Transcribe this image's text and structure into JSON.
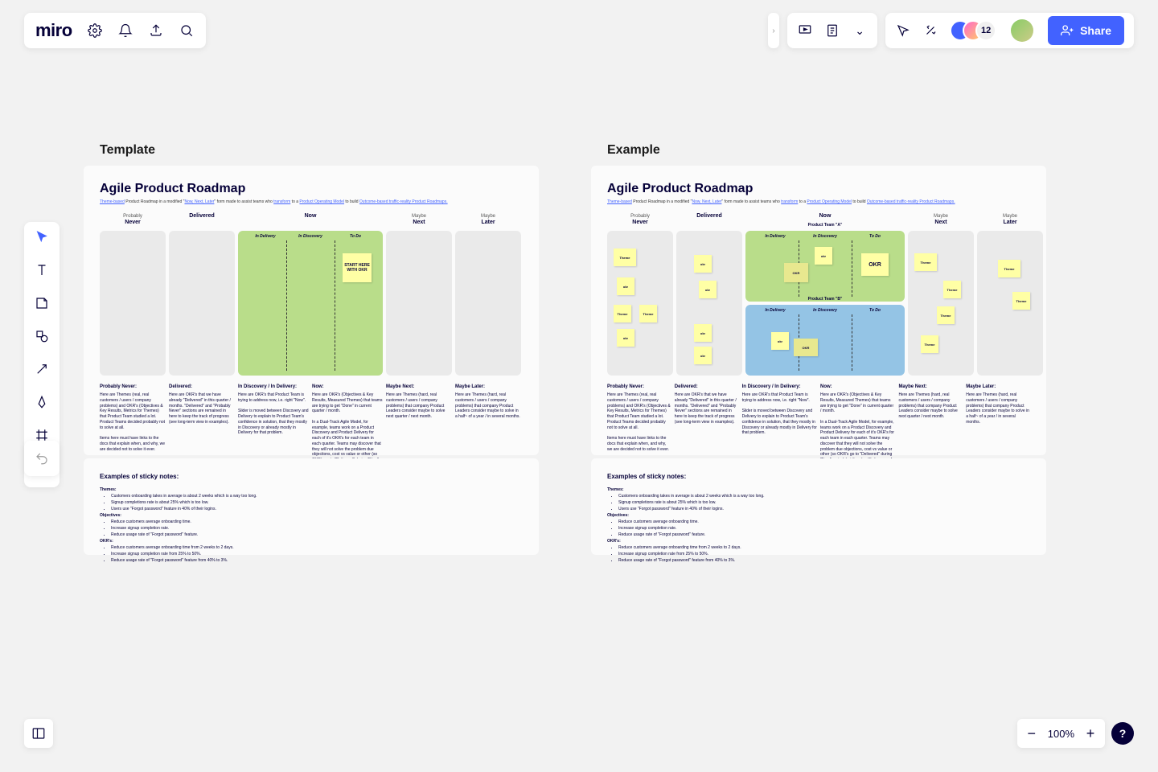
{
  "logo": "miro",
  "share_label": "Share",
  "avatar_count": "12",
  "zoom": "100%",
  "help": "?",
  "section_template": "Template",
  "section_example": "Example",
  "card": {
    "title": "Agile Product Roadmap",
    "sub_prefix": "Theme-based",
    "sub_mid": " Product Roadmap in a modified \"",
    "sub_link1": "Now, Next, Later",
    "sub_mid2": "\" form made to assist teams who ",
    "sub_link2": "transform",
    "sub_mid3": " to a ",
    "sub_link3": "Product Operating Model",
    "sub_mid4": " to build ",
    "sub_link4": "Outcome-based traffic-reality Product Roadmaps.",
    "lanes": {
      "never_sup": "Probably",
      "never": "Never",
      "delivered": "Delivered",
      "now": "Now",
      "now_sub1": "In Delivery",
      "now_sub2": "In Discovery",
      "now_sub3": "To Do",
      "next_sup": "Maybe",
      "next": "Next",
      "later_sup": "Maybe",
      "later": "Later",
      "teamA": "Product Team \"A\"",
      "teamB": "Product Team \"B\""
    },
    "start_sticky": "START HERE WITH OKR",
    "okr": "OKR",
    "okr_lc": "okr",
    "theme": "Theme",
    "desc": {
      "never_h": "Probably Never:",
      "never_t1": "Here are Themes (real, real customers / users / company problems) and OKR's (Objectives & Key Results, Metrics for Themes) that Product Team studied a lot. Product Teams decided probably not to solve at all.",
      "never_t2": "Items here must have links to the docs that explain when, and why, we are decided not to solve it ever.",
      "delivered_h": "Delivered:",
      "delivered_t": "Here are OKR's that we have already \"Delivered\" in this quarter / months. \"Delivered\" and \"Probably Never\" sections are remained in here to keep the track of progress (see long-term view in examples).",
      "disc_h": "In Discovery / In Delivery:",
      "disc_t1": "Here are OKR's that Product Team is trying to address now, i.e. right \"Now\".",
      "disc_t2": "Slider is moved between Discovery and Delivery to explain to Product Team's confidence in solution, that they mostly in Discovery or already mostly in Delivery for that problem.",
      "now_h": "Now:",
      "now_t1": "Here are OKR's (Objectives & Key Results, Measured Themes) that teams are trying to get \"Done\" in current quarter / month.",
      "now_t2": "In a Dual-Track Agile Model, for example, teams work on a Product Discovery and Product Delivery for each of it's OKR's for each team in each quarter. Teams may discover that they will not solve the problem due objections, cost vs value or other (so OKR's go to \"Delivered\" during \"Now\" period, but there's still chances of moving them to \"Never\" / \"Next\" / \"Later\" as well).",
      "next_h": "Maybe Next:",
      "next_t": "Here are Themes (hard, real customers / users / company problems) that company Product Leaders consider maybe to solve next quarter / next month.",
      "later_h": "Maybe Later:",
      "later_t": "Here are Themes (hard, real customers / users / company problems) that company Product Leaders consider maybe to solve in a half~ of a year / in several months."
    }
  },
  "examples": {
    "title": "Examples of sticky notes:",
    "themes_h": "Themes:",
    "themes": [
      "Customers onboarding takes in average is about 2 weeks which is a way too long.",
      "Signup completions rate is about 25% which is too low.",
      "Users use \"Forgot password\" feature in 40% of their logins."
    ],
    "obj_h": "Objectives:",
    "obj": [
      "Reduce customers average onboarding time.",
      "Increase signup completion rate.",
      "Reduce usage rate of \"Forgot password\" feature."
    ],
    "okr_h": "OKR's:",
    "okr": [
      "Reduce customers average onboarding time from 2 weeks to 2 days.",
      "Increase signup completion rate from 25% to 50%.",
      "Reduce usage rate of \"Forgot password\" feature from 40% to 3%."
    ]
  }
}
